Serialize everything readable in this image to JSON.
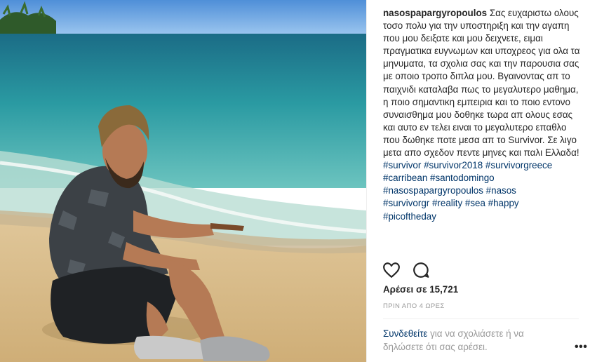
{
  "post": {
    "username": "nasospapargyropoulos",
    "caption": "Σας ευχαριστω ολους τοσο πολυ για την υποστηριξη και την αγαπη που μου δειξατε και μου δειχνετε, ειμαι πραγματικα ευγνωμων και υποχρεος για ολα τα μηνυματα, τα σχολια σας και την παρουσια σας με οποιο τροπο διπλα μου. Βγαινοντας απ το παιχνιδι καταλαβα πως το μεγαλυτερο μαθημα, η ποιο σημαντικη εμπειρια και το ποιο εντονο συναισθημα μου δοθηκε τωρα απ ολους εσας και αυτο εν τελει ειναι το μεγαλυτερο επαθλο που δωθηκε ποτε μεσα απ το Survivor. Σε λιγο μετα απο σχεδον πεντε μηνες και παλι Ελλαδα!",
    "hashtags": [
      "#survivor",
      "#survivor2018",
      "#survivorgreece",
      "#carribean",
      "#santodomingo",
      "#nasospapargyropoulos",
      "#nasos",
      "#survivorgr",
      "#reality",
      "#sea",
      "#happy",
      "#picoftheday"
    ],
    "likes": "Αρέσει σε 15,721",
    "timestamp": "ΠΡΙΝ ΑΠΟ 4 ΩΡΕΣ"
  },
  "actions": {
    "like_icon": "heart-icon",
    "comment_icon": "comment-icon"
  },
  "comment_box": {
    "login_link": "Συνδεθείτε",
    "prompt": " για να σχολιάσετε ή να δηλώσετε ότι σας αρέσει.",
    "more": "•••"
  },
  "colors": {
    "link": "#003569",
    "text": "#262626",
    "muted": "#999999",
    "border": "#efefef"
  }
}
